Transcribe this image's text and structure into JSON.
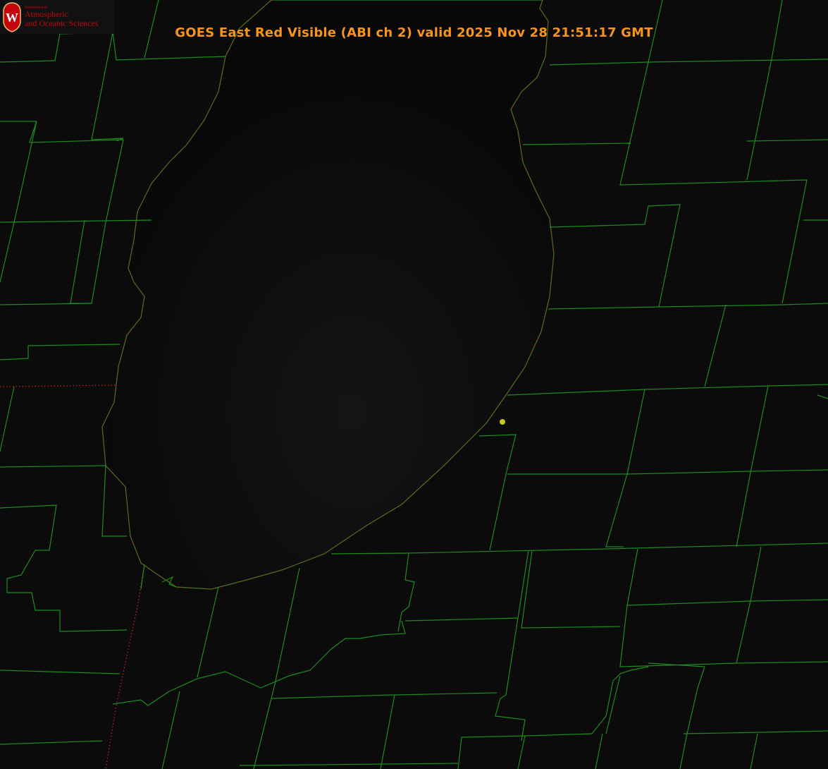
{
  "title": "GOES East Red Visible (ABI ch 2) valid 2025 Nov 28 21:51:17 GMT",
  "logo": {
    "department": "Department of",
    "line1": "Atmospheric",
    "line2": "and Oceanic Sciences",
    "seal_letter": "W"
  },
  "colors": {
    "background": "#0b0b0b",
    "lake": "#070707",
    "county_lines": "#1f8a1f",
    "shoreline_dots": "#d42020",
    "title": "#f7941d",
    "marker": "#c8c820",
    "brand": "#c5050c"
  },
  "map": {
    "marker_icon": "station-dot-icon"
  }
}
